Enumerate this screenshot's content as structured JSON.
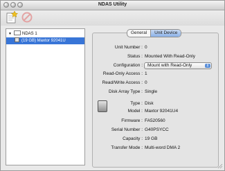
{
  "window": {
    "title": "NDAS Utility"
  },
  "toolbar": {
    "register_icon": "register-icon",
    "unregister_icon": "unregister-icon"
  },
  "sidebar": {
    "device": {
      "label": "NDAS 1",
      "icon": "ndas-device-icon"
    },
    "unit": {
      "label": "(19 GB) Maxtor 92041U",
      "icon": "disk-icon"
    }
  },
  "tabs": [
    {
      "label": "General",
      "active": false
    },
    {
      "label": "Unit Device",
      "active": true
    }
  ],
  "unit_info": [
    {
      "label": "Unit Number :",
      "value": "0"
    },
    {
      "label": "Status :",
      "value": "Mounted With Read-Only"
    },
    {
      "label": "Configuration :",
      "value": "Mount with Read-Only"
    },
    {
      "label": "Read-Only Access :",
      "value": "1"
    },
    {
      "label": "Read/Write Access :",
      "value": "0"
    },
    {
      "label": "Disk Array Type :",
      "value": "Single"
    }
  ],
  "disk_info": [
    {
      "label": "Type :",
      "value": "Disk"
    },
    {
      "label": "Model :",
      "value": "Maxtor 92041U4"
    },
    {
      "label": "Firmware :",
      "value": "FA520560"
    },
    {
      "label": "Serial Number :",
      "value": "G40PSYCC"
    },
    {
      "label": "Capacity :",
      "value": "19 GB"
    },
    {
      "label": "Transfer Mode :",
      "value": "Multi-word DMA 2"
    }
  ],
  "colors": {
    "selection": "#3875d7",
    "tab_active": "#8cb2e8"
  }
}
